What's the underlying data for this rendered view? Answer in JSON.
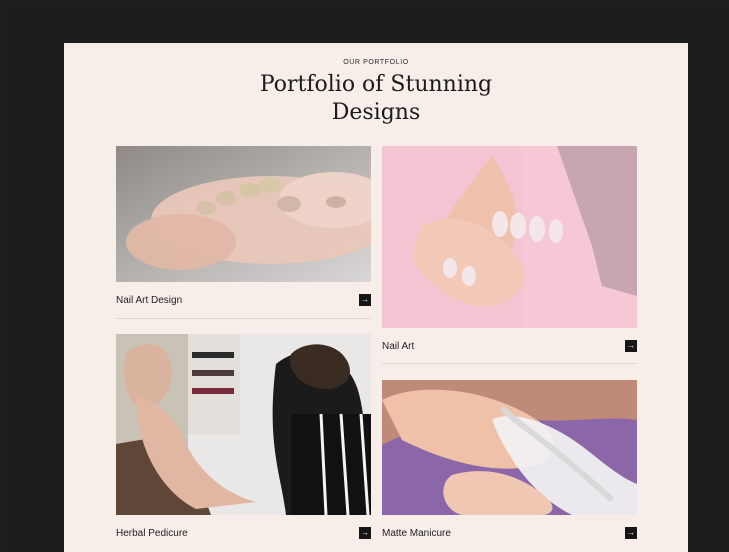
{
  "header": {
    "eyebrow": "OUR PORTFOLIO",
    "title_line1": "Portfolio of Stunning",
    "title_line2": "Designs"
  },
  "cards": [
    {
      "label": "Nail Art Design",
      "arrow": "→"
    },
    {
      "label": "Nail Art",
      "arrow": "→"
    },
    {
      "label": "Herbal Pedicure",
      "arrow": "→"
    },
    {
      "label": "Matte Manicure",
      "arrow": "→"
    }
  ],
  "colors": {
    "page_bg": "#f7eee9",
    "frame_bg": "#1f1f1f",
    "button_bg": "#161616",
    "text": "#1b1b1b"
  },
  "icons": [
    "arrow-right-icon"
  ]
}
